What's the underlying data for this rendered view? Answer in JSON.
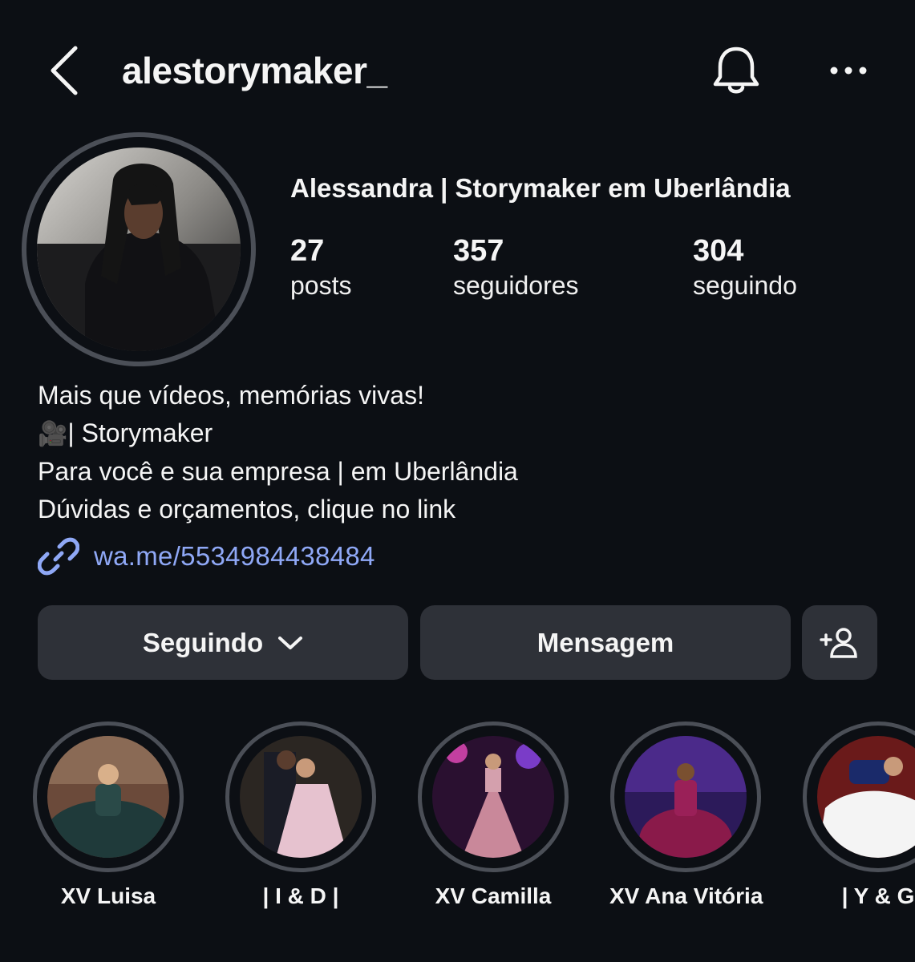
{
  "header": {
    "username": "alestorymaker_"
  },
  "profile": {
    "full_name": "Alessandra | Storymaker em Uberlândia",
    "stats": [
      {
        "value": "27",
        "label": "posts"
      },
      {
        "value": "357",
        "label": "seguidores"
      },
      {
        "value": "304",
        "label": "seguindo"
      }
    ],
    "bio": {
      "line1": "Mais que vídeos, memórias vivas!",
      "line2_icon": "🎥",
      "line2": "| Storymaker",
      "line3": "Para você e sua empresa | em Uberlândia",
      "line4": "Dúvidas e orçamentos, clique no link"
    },
    "link": "wa.me/5534984438484"
  },
  "actions": {
    "following_label": "Seguindo",
    "message_label": "Mensagem"
  },
  "highlights": [
    {
      "label": "XV Luisa"
    },
    {
      "label": "| I & D |"
    },
    {
      "label": "XV Camilla"
    },
    {
      "label": "XV Ana Vitória"
    },
    {
      "label": "| Y & G"
    }
  ],
  "colors": {
    "background": "#0c0f14",
    "button": "#2e3138",
    "ring": "#4b4f57",
    "link": "#8fa8f6"
  },
  "icons": [
    "back-icon",
    "bell-icon",
    "more-icon",
    "link-icon",
    "chevron-down-icon",
    "add-person-icon"
  ]
}
